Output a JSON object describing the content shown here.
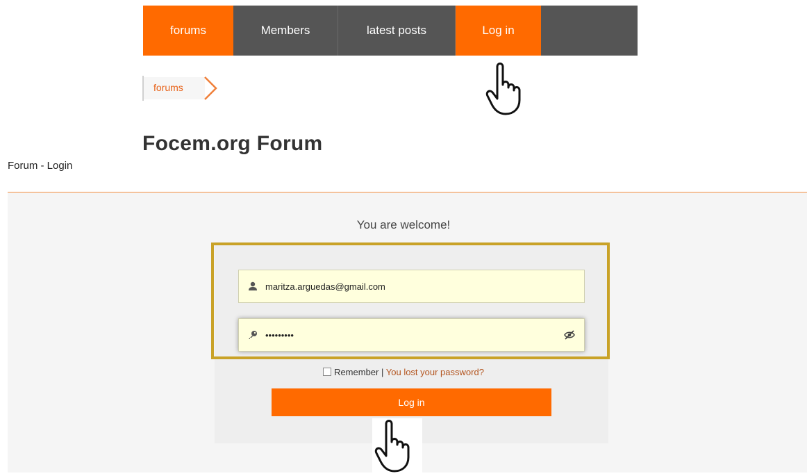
{
  "nav": {
    "items": [
      {
        "label": "forums"
      },
      {
        "label": "Members"
      },
      {
        "label": "latest posts"
      },
      {
        "label": "Log in"
      }
    ]
  },
  "breadcrumb": {
    "label": "forums"
  },
  "forum_title": "Focem.org Forum",
  "page_subtitle": "Forum - Login",
  "login": {
    "welcome": "You are welcome!",
    "username_value": "maritza.arguedas@gmail.com",
    "password_value": "•••••••••",
    "remember_label": "Remember",
    "separator": "|",
    "lost_password_label": "You lost your password?",
    "submit_label": "Log in"
  },
  "icons": {
    "user": "user-icon",
    "key": "key-icon",
    "eye": "eye-slash-icon",
    "pointer": "hand-pointer-icon",
    "chevron": "chevron-right-icon"
  },
  "colors": {
    "accent": "#ff6a00",
    "nav_bg": "#555555",
    "highlight_border": "#c9a227",
    "field_bg": "#ffffdd",
    "link": "#b3541e"
  }
}
